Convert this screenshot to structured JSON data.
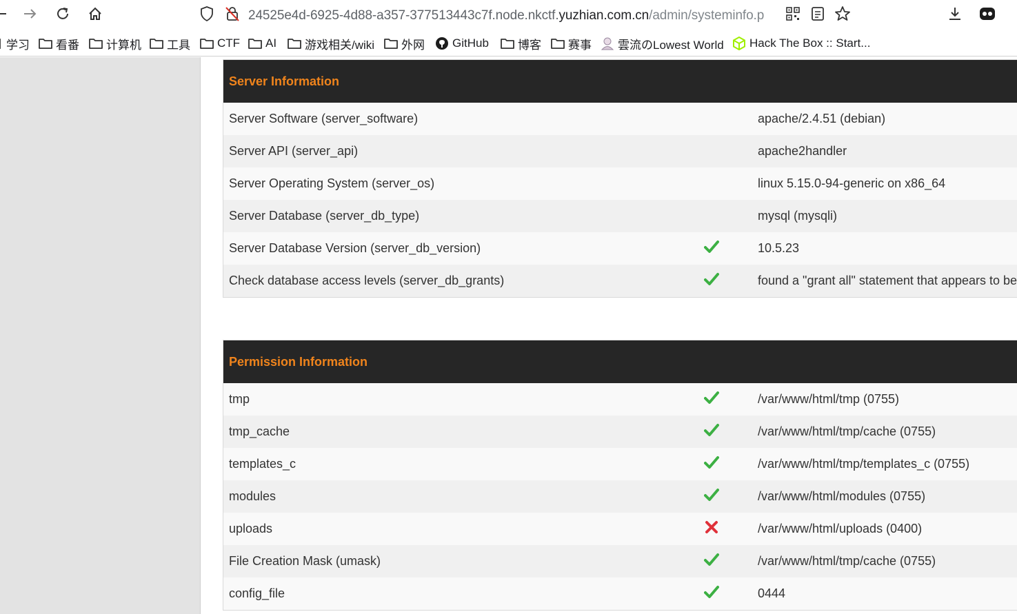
{
  "browser": {
    "url_prefix": "24525e4d-6925-4d88-a357-377513443c7f.node.nkctf.",
    "url_host": "yuzhian.com.cn",
    "url_path": "/admin/systeminfo.p"
  },
  "bookmarks": [
    {
      "label": "学习",
      "icon": "folder-icon"
    },
    {
      "label": "看番",
      "icon": "folder-icon"
    },
    {
      "label": "计算机",
      "icon": "folder-icon"
    },
    {
      "label": "工具",
      "icon": "folder-icon"
    },
    {
      "label": "CTF",
      "icon": "folder-icon"
    },
    {
      "label": "AI",
      "icon": "folder-icon"
    },
    {
      "label": "游戏相关/wiki",
      "icon": "folder-icon"
    },
    {
      "label": "外网",
      "icon": "folder-icon"
    },
    {
      "label": "GitHub",
      "icon": "github-icon"
    },
    {
      "label": "博客",
      "icon": "folder-icon"
    },
    {
      "label": "赛事",
      "icon": "folder-icon"
    },
    {
      "label": "雲流のLowest World",
      "icon": "avatar-icon"
    },
    {
      "label": "Hack The Box :: Start...",
      "icon": "htb-cube-icon"
    }
  ],
  "server_section": {
    "title": "Server Information",
    "rows": [
      {
        "label": "Server Software (server_software)",
        "status": "",
        "value": "apache/2.4.51 (debian)"
      },
      {
        "label": "Server API (server_api)",
        "status": "",
        "value": "apache2handler"
      },
      {
        "label": "Server Operating System (server_os)",
        "status": "",
        "value": "linux 5.15.0-94-generic on x86_64"
      },
      {
        "label": "Server Database (server_db_type)",
        "status": "",
        "value": "mysql (mysqli)"
      },
      {
        "label": "Server Database Version (server_db_version)",
        "status": "ok",
        "value": "10.5.23"
      },
      {
        "label": "Check database access levels (server_db_grants)",
        "status": "ok",
        "value": "found a \"grant all\" statement that appears to be"
      }
    ]
  },
  "permission_section": {
    "title": "Permission Information",
    "rows": [
      {
        "label": "tmp",
        "status": "ok",
        "value": "/var/www/html/tmp (0755)"
      },
      {
        "label": "tmp_cache",
        "status": "ok",
        "value": "/var/www/html/tmp/cache (0755)"
      },
      {
        "label": "templates_c",
        "status": "ok",
        "value": "/var/www/html/tmp/templates_c (0755)"
      },
      {
        "label": "modules",
        "status": "ok",
        "value": "/var/www/html/modules (0755)"
      },
      {
        "label": "uploads",
        "status": "fail",
        "value": "/var/www/html/uploads (0400)"
      },
      {
        "label": "File Creation Mask (umask)",
        "status": "ok",
        "value": "/var/www/html/tmp/cache (0755)"
      },
      {
        "label": "config_file",
        "status": "ok",
        "value": "0444"
      }
    ]
  },
  "colors": {
    "section_header_bg": "#262626",
    "section_header_text": "#f0841c",
    "ok": "#3cb043",
    "fail": "#e0313a"
  }
}
